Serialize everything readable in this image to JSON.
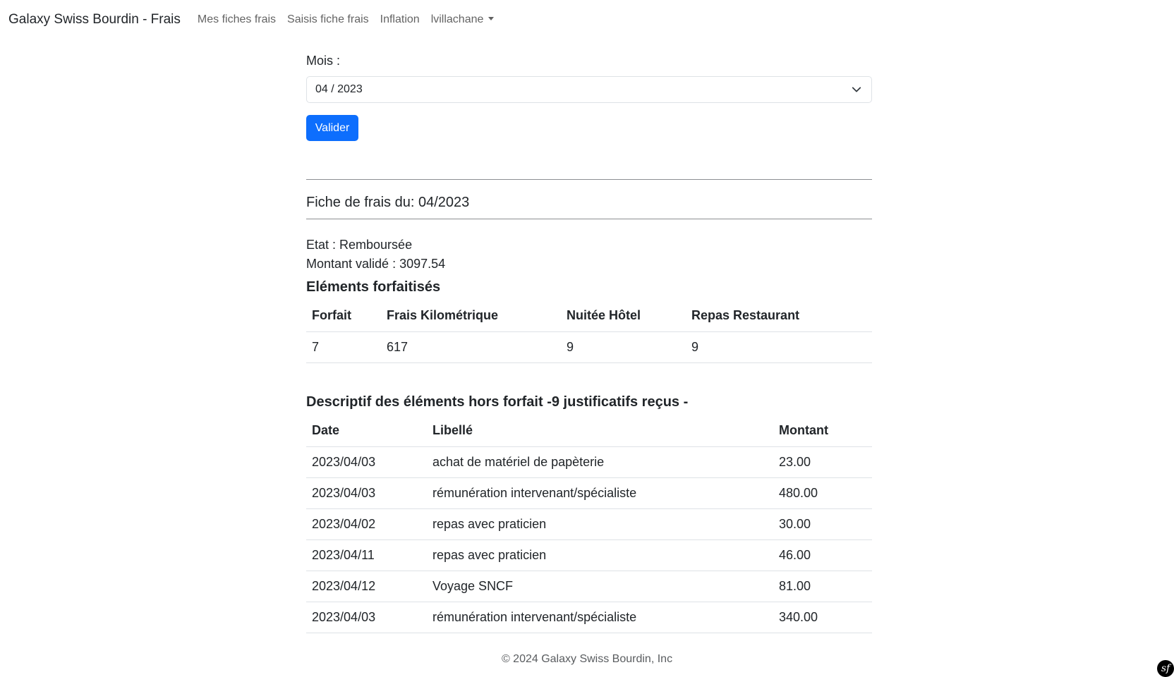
{
  "navbar": {
    "brand": "Galaxy Swiss Bourdin - Frais",
    "links": [
      "Mes fiches frais",
      "Saisis fiche frais",
      "Inflation"
    ],
    "user": "lvillachane"
  },
  "form": {
    "mois_label": "Mois :",
    "selected_month": "04 / 2023",
    "submit_label": "Valider"
  },
  "fiche": {
    "title": "Fiche de frais du: 04/2023",
    "etat": "Etat : Remboursée",
    "montant_valide": "Montant validé : 3097.54"
  },
  "forfait_section": {
    "title": "Eléments forfaitisés",
    "headers": [
      "Forfait",
      "Frais Kilométrique",
      "Nuitée Hôtel",
      "Repas Restaurant"
    ],
    "row": [
      "7",
      "617",
      "9",
      "9"
    ]
  },
  "hors_forfait_section": {
    "title": "Descriptif des éléments hors forfait -9 justificatifs reçus -",
    "headers": [
      "Date",
      "Libellé",
      "Montant"
    ],
    "rows": [
      [
        "2023/04/03",
        "achat de matériel de papèterie",
        "23.00"
      ],
      [
        "2023/04/03",
        "rémunération intervenant/spécialiste",
        "480.00"
      ],
      [
        "2023/04/02",
        "repas avec praticien",
        "30.00"
      ],
      [
        "2023/04/11",
        "repas avec praticien",
        "46.00"
      ],
      [
        "2023/04/12",
        "Voyage SNCF",
        "81.00"
      ],
      [
        "2023/04/03",
        "rémunération intervenant/spécialiste",
        "340.00"
      ]
    ]
  },
  "footer": {
    "text": "© 2024 Galaxy Swiss Bourdin, Inc"
  },
  "icons": {
    "dev_toolbar": "symfony-icon",
    "select": "chevron-down-icon"
  },
  "colors": {
    "primary": "#0d6efd"
  }
}
